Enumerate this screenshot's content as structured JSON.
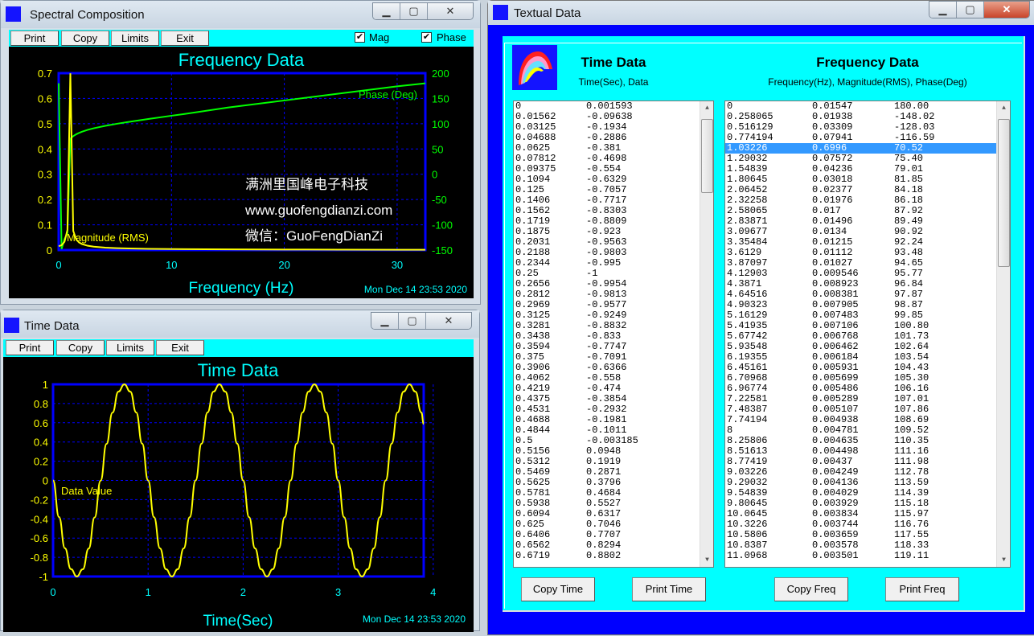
{
  "spectral_window": {
    "title": "Spectral Composition",
    "toolbar": [
      "Print",
      "Copy",
      "Limits",
      "Exit"
    ],
    "mag_label": "Mag",
    "phase_label": "Phase",
    "mag_checked": true,
    "phase_checked": true
  },
  "time_window": {
    "title": "Time Data",
    "toolbar": [
      "Print",
      "Copy",
      "Limits",
      "Exit"
    ]
  },
  "textual_window": {
    "title": "Textual Data",
    "time_heading": "Time Data",
    "time_sub": "Time(Sec), Data",
    "freq_heading": "Frequency Data",
    "freq_sub": "Frequency(Hz), Magnitude(RMS), Phase(Deg)",
    "buttons": [
      "Copy Time",
      "Print Time",
      "Copy Freq",
      "Print Freq"
    ],
    "selected_freq_row": 4,
    "time_rows": [
      [
        "0",
        "0.001593"
      ],
      [
        "0.01562",
        "-0.09638"
      ],
      [
        "0.03125",
        "-0.1934"
      ],
      [
        "0.04688",
        "-0.2886"
      ],
      [
        "0.0625",
        "-0.381"
      ],
      [
        "0.07812",
        "-0.4698"
      ],
      [
        "0.09375",
        "-0.554"
      ],
      [
        "0.1094",
        "-0.6329"
      ],
      [
        "0.125",
        "-0.7057"
      ],
      [
        "0.1406",
        "-0.7717"
      ],
      [
        "0.1562",
        "-0.8303"
      ],
      [
        "0.1719",
        "-0.8809"
      ],
      [
        "0.1875",
        "-0.923"
      ],
      [
        "0.2031",
        "-0.9563"
      ],
      [
        "0.2188",
        "-0.9803"
      ],
      [
        "0.2344",
        "-0.995"
      ],
      [
        "0.25",
        "-1"
      ],
      [
        "0.2656",
        "-0.9954"
      ],
      [
        "0.2812",
        "-0.9813"
      ],
      [
        "0.2969",
        "-0.9577"
      ],
      [
        "0.3125",
        "-0.9249"
      ],
      [
        "0.3281",
        "-0.8832"
      ],
      [
        "0.3438",
        "-0.833"
      ],
      [
        "0.3594",
        "-0.7747"
      ],
      [
        "0.375",
        "-0.7091"
      ],
      [
        "0.3906",
        "-0.6366"
      ],
      [
        "0.4062",
        "-0.558"
      ],
      [
        "0.4219",
        "-0.474"
      ],
      [
        "0.4375",
        "-0.3854"
      ],
      [
        "0.4531",
        "-0.2932"
      ],
      [
        "0.4688",
        "-0.1981"
      ],
      [
        "0.4844",
        "-0.1011"
      ],
      [
        "0.5",
        "-0.003185"
      ],
      [
        "0.5156",
        "0.0948"
      ],
      [
        "0.5312",
        "0.1919"
      ],
      [
        "0.5469",
        "0.2871"
      ],
      [
        "0.5625",
        "0.3796"
      ],
      [
        "0.5781",
        "0.4684"
      ],
      [
        "0.5938",
        "0.5527"
      ],
      [
        "0.6094",
        "0.6317"
      ],
      [
        "0.625",
        "0.7046"
      ],
      [
        "0.6406",
        "0.7707"
      ],
      [
        "0.6562",
        "0.8294"
      ],
      [
        "0.6719",
        "0.8802"
      ]
    ],
    "freq_rows": [
      [
        "0",
        "0.01547",
        "180.00"
      ],
      [
        "0.258065",
        "0.01938",
        "-148.02"
      ],
      [
        "0.516129",
        "0.03309",
        "-128.03"
      ],
      [
        "0.774194",
        "0.07941",
        "-116.59"
      ],
      [
        "1.03226",
        "0.6996",
        "70.52"
      ],
      [
        "1.29032",
        "0.07572",
        "75.40"
      ],
      [
        "1.54839",
        "0.04236",
        "79.01"
      ],
      [
        "1.80645",
        "0.03018",
        "81.85"
      ],
      [
        "2.06452",
        "0.02377",
        "84.18"
      ],
      [
        "2.32258",
        "0.01976",
        "86.18"
      ],
      [
        "2.58065",
        "0.017",
        "87.92"
      ],
      [
        "2.83871",
        "0.01496",
        "89.49"
      ],
      [
        "3.09677",
        "0.0134",
        "90.92"
      ],
      [
        "3.35484",
        "0.01215",
        "92.24"
      ],
      [
        "3.6129",
        "0.01112",
        "93.48"
      ],
      [
        "3.87097",
        "0.01027",
        "94.65"
      ],
      [
        "4.12903",
        "0.009546",
        "95.77"
      ],
      [
        "4.3871",
        "0.008923",
        "96.84"
      ],
      [
        "4.64516",
        "0.008381",
        "97.87"
      ],
      [
        "4.90323",
        "0.007905",
        "98.87"
      ],
      [
        "5.16129",
        "0.007483",
        "99.85"
      ],
      [
        "5.41935",
        "0.007106",
        "100.80"
      ],
      [
        "5.67742",
        "0.006768",
        "101.73"
      ],
      [
        "5.93548",
        "0.006462",
        "102.64"
      ],
      [
        "6.19355",
        "0.006184",
        "103.54"
      ],
      [
        "6.45161",
        "0.005931",
        "104.43"
      ],
      [
        "6.70968",
        "0.005699",
        "105.30"
      ],
      [
        "6.96774",
        "0.005486",
        "106.16"
      ],
      [
        "7.22581",
        "0.005289",
        "107.01"
      ],
      [
        "7.48387",
        "0.005107",
        "107.86"
      ],
      [
        "7.74194",
        "0.004938",
        "108.69"
      ],
      [
        "8",
        "0.004781",
        "109.52"
      ],
      [
        "8.25806",
        "0.004635",
        "110.35"
      ],
      [
        "8.51613",
        "0.004498",
        "111.16"
      ],
      [
        "8.77419",
        "0.00437",
        "111.98"
      ],
      [
        "9.03226",
        "0.004249",
        "112.78"
      ],
      [
        "9.29032",
        "0.004136",
        "113.59"
      ],
      [
        "9.54839",
        "0.004029",
        "114.39"
      ],
      [
        "9.80645",
        "0.003929",
        "115.18"
      ],
      [
        "10.0645",
        "0.003834",
        "115.97"
      ],
      [
        "10.3226",
        "0.003744",
        "116.76"
      ],
      [
        "10.5806",
        "0.003659",
        "117.55"
      ],
      [
        "10.8387",
        "0.003578",
        "118.33"
      ],
      [
        "11.0968",
        "0.003501",
        "119.11"
      ]
    ]
  },
  "chart_data": [
    {
      "type": "line",
      "title": "Frequency Data",
      "xlabel": "Frequency (Hz)",
      "timestamp": "Mon Dec 14 23:53 2020",
      "xlim": [
        0,
        32.5
      ],
      "ylim_left": [
        0,
        0.7
      ],
      "ylim_right": [
        -150,
        200
      ],
      "grid": true,
      "xticks": [
        "0",
        "10",
        "20",
        "30"
      ],
      "yticks_left": [
        "0.7",
        "0.6",
        "0.5",
        "0.4",
        "0.3",
        "0.2",
        "0.1",
        "0"
      ],
      "yticks_right": [
        "200",
        "150",
        "100",
        "50",
        "0",
        "-50",
        "-100",
        "-150"
      ],
      "watermark": [
        "满洲里国峰电子科技",
        "www.guofengdianzi.com",
        "微信：GuoFengDianZi"
      ],
      "colors": {
        "magnitude": "#ffff00",
        "phase": "#00ff00",
        "title": "#00ffff",
        "frame": "#0000ff"
      },
      "series": [
        {
          "name": "Magnitude (RMS)",
          "axis": "left",
          "x": [
            0,
            0.258065,
            0.516129,
            0.774194,
            1.03226,
            1.29032,
            1.54839,
            1.80645,
            2.06452,
            2.58065,
            3.09677,
            4.12903,
            5.16129,
            6.19355,
            8,
            10.0645,
            11.0968,
            15,
            20,
            25,
            30,
            32.5
          ],
          "y": [
            0.01547,
            0.01938,
            0.03309,
            0.07941,
            0.6996,
            0.07572,
            0.04236,
            0.03018,
            0.02377,
            0.017,
            0.0134,
            0.009546,
            0.007483,
            0.006184,
            0.004781,
            0.003834,
            0.003501,
            0.0026,
            0.002,
            0.0016,
            0.0013,
            0.0012
          ]
        },
        {
          "name": "Phase (Deg)",
          "axis": "right",
          "x": [
            0,
            0.258065,
            0.516129,
            0.774194,
            1.03226,
            1.29032,
            1.54839,
            1.80645,
            2.06452,
            2.58065,
            3.09677,
            4.12903,
            5.16129,
            6.19355,
            8,
            10.0645,
            11.0968,
            15,
            20,
            25,
            30,
            32.5
          ],
          "y": [
            180,
            -148.02,
            -128.03,
            -116.59,
            70.52,
            75.4,
            79.01,
            81.85,
            84.18,
            87.92,
            90.92,
            95.77,
            99.85,
            103.54,
            109.52,
            115.97,
            119.11,
            132,
            146,
            160,
            174,
            180
          ]
        }
      ]
    },
    {
      "type": "line",
      "title": "Time Data",
      "xlabel": "Time(Sec)",
      "timestamp": "Mon Dec 14 23:53 2020",
      "xlim": [
        0,
        3.9
      ],
      "ylim": [
        -1,
        1
      ],
      "grid": true,
      "xticks": [
        "0",
        "1",
        "2",
        "3",
        "4"
      ],
      "yticks": [
        "1",
        "0.8",
        "0.6",
        "0.4",
        "0.2",
        "0",
        "-0.2",
        "-0.4",
        "-0.6",
        "-0.8",
        "-1"
      ],
      "colors": {
        "line": "#ffff00",
        "title": "#00ffff",
        "frame": "#0000ff"
      },
      "series": [
        {
          "name": "Data Value",
          "x": [
            0,
            0.0625,
            0.125,
            0.1875,
            0.25,
            0.3125,
            0.375,
            0.4375,
            0.5,
            0.5625,
            0.625,
            0.6875,
            0.75,
            0.8125,
            0.875,
            0.9375,
            1,
            1.0625,
            1.125,
            1.1875,
            1.25,
            1.3125,
            1.375,
            1.4375,
            1.5,
            1.5625,
            1.625,
            1.6875,
            1.75,
            1.8125,
            1.875,
            1.9375,
            2,
            2.0625,
            2.125,
            2.1875,
            2.25,
            2.3125,
            2.375,
            2.4375,
            2.5,
            2.5625,
            2.625,
            2.6875,
            2.75,
            2.8125,
            2.875,
            2.9375,
            3,
            3.0625,
            3.125,
            3.1875,
            3.25,
            3.3125,
            3.375,
            3.4375,
            3.5,
            3.5625,
            3.625,
            3.6875,
            3.75,
            3.8125,
            3.875,
            3.9
          ],
          "y": [
            0,
            -0.381,
            -0.7057,
            -0.923,
            -1,
            -0.9249,
            -0.7091,
            -0.3854,
            -0.003,
            0.3796,
            0.7046,
            0.9239,
            1,
            0.9239,
            0.7071,
            0.3827,
            0,
            -0.3827,
            -0.7071,
            -0.9239,
            -1,
            -0.9239,
            -0.7071,
            -0.3827,
            0,
            0.3827,
            0.7071,
            0.9239,
            1,
            0.9239,
            0.7071,
            0.3827,
            0,
            -0.3827,
            -0.7071,
            -0.9239,
            -1,
            -0.9239,
            -0.7071,
            -0.3827,
            0,
            0.3827,
            0.7071,
            0.9239,
            1,
            0.9239,
            0.7071,
            0.3827,
            0,
            -0.3827,
            -0.7071,
            -0.9239,
            -1,
            -0.9239,
            -0.7071,
            -0.3827,
            0,
            0.3827,
            0.7071,
            0.9239,
            1,
            0.9239,
            0.7071,
            0.5878
          ]
        }
      ]
    }
  ]
}
